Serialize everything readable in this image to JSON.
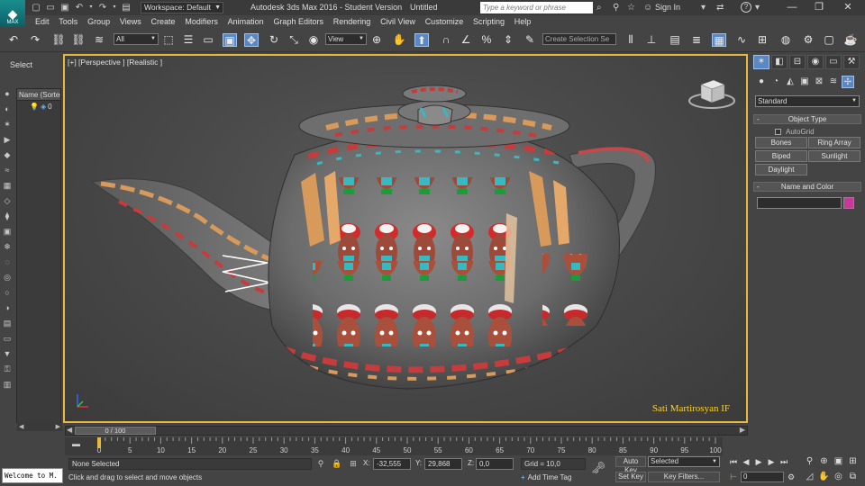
{
  "title_bar": {
    "logo_text": "MAX",
    "workspace_label": "Workspace: Default",
    "app_title": "Autodesk 3ds Max 2016 - Student Version",
    "document_name": "Untitled",
    "search_placeholder": "Type a keyword or phrase",
    "sign_in_label": "Sign In",
    "help_label": "?"
  },
  "menu": {
    "items": [
      "Edit",
      "Tools",
      "Group",
      "Views",
      "Create",
      "Modifiers",
      "Animation",
      "Graph Editors",
      "Rendering",
      "Civil View",
      "Customize",
      "Scripting",
      "Help"
    ]
  },
  "toolbar": {
    "filter_value": "All",
    "ref_coord_value": "View",
    "named_selection_placeholder": "Create Selection Se"
  },
  "left_panel": {
    "select_label": "Select",
    "explorer_header": "Name (Sorted",
    "row_label": "0"
  },
  "viewport": {
    "label": "[+] [Perspective ] [Realistic ]",
    "watermark": "Sati Martirosyan IF"
  },
  "command_panel": {
    "category_value": "Standard",
    "object_type_title": "Object Type",
    "autogrid_label": "AutoGrid",
    "buttons": [
      "Bones",
      "Ring Array",
      "Biped",
      "Sunlight",
      "Daylight"
    ],
    "name_color_title": "Name and Color",
    "swatch_color": "#c8389a"
  },
  "timeline": {
    "slider_label": "0 / 100",
    "ticks": [
      0,
      5,
      10,
      15,
      20,
      25,
      30,
      35,
      40,
      45,
      50,
      55,
      60,
      65,
      70,
      75,
      80,
      85,
      90,
      95,
      100
    ]
  },
  "status": {
    "maxscript_text": "Welcome to M.",
    "selection_text": "None Selected",
    "prompt_text": "Click and drag to select and move objects",
    "x_label": "X:",
    "x_value": "-32,555",
    "y_label": "Y:",
    "y_value": "29,868",
    "z_label": "Z:",
    "z_value": "0,0",
    "grid_text": "Grid = 10,0",
    "add_time_tag": "Add Time Tag",
    "auto_key": "Auto Key",
    "set_key": "Set Key",
    "selected_value": "Selected",
    "key_filters": "Key Filters...",
    "frame_value": "0"
  },
  "colors": {
    "viewport_border": "#e6b840",
    "active_blue": "#5a88c4",
    "watermark": "#ffd21e"
  }
}
